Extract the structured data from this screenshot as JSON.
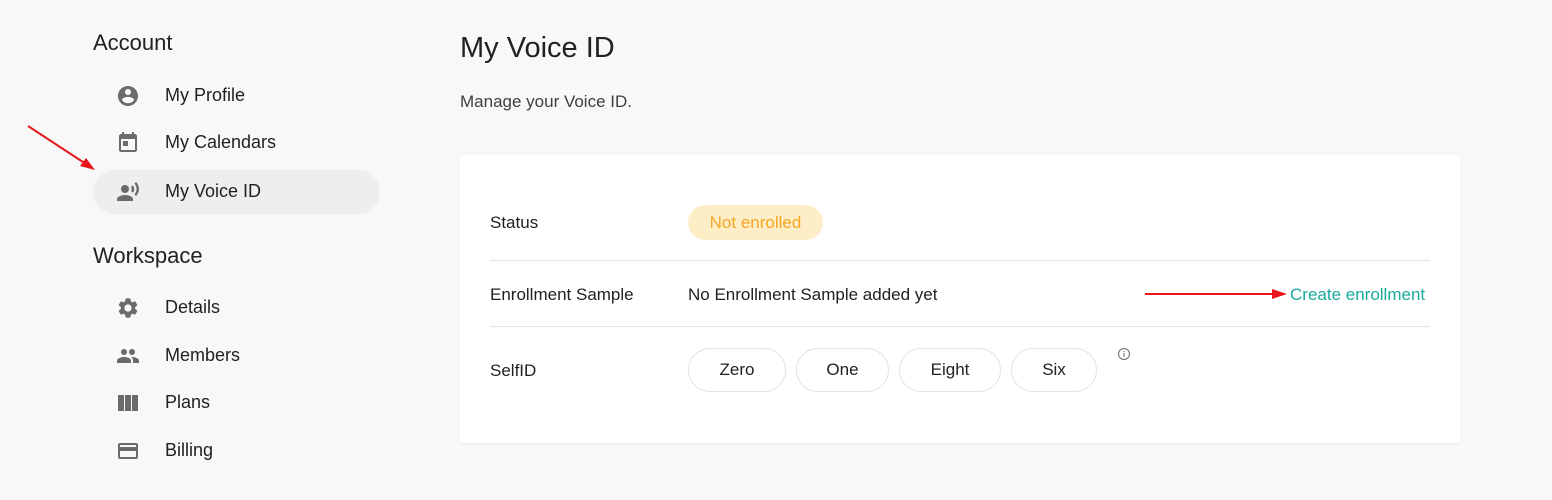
{
  "sidebar": {
    "account_title": "Account",
    "account_items": [
      {
        "label": "My Profile",
        "icon": "account-circle-icon"
      },
      {
        "label": "My Calendars",
        "icon": "calendar-icon"
      },
      {
        "label": "My Voice ID",
        "icon": "record-voice-icon",
        "active": true
      }
    ],
    "workspace_title": "Workspace",
    "workspace_items": [
      {
        "label": "Details",
        "icon": "gear-icon"
      },
      {
        "label": "Members",
        "icon": "people-icon"
      },
      {
        "label": "Plans",
        "icon": "columns-icon"
      },
      {
        "label": "Billing",
        "icon": "credit-card-icon"
      }
    ]
  },
  "main": {
    "title": "My Voice ID",
    "subtitle": "Manage your Voice ID.",
    "status": {
      "label": "Status",
      "badge": "Not enrolled"
    },
    "enrollment": {
      "label": "Enrollment Sample",
      "value": "No Enrollment Sample added yet",
      "action": "Create enrollment"
    },
    "selfid": {
      "label": "SelfID",
      "words": [
        "Zero",
        "One",
        "Eight",
        "Six"
      ]
    }
  },
  "colors": {
    "accent": "#1aaa9e",
    "badge_bg": "#fdeec8",
    "badge_text": "#f5a623",
    "annotation_arrow": "#e8161b",
    "active_nav_bg": "#eeeeee",
    "icon_gray": "#6b6b6b"
  }
}
